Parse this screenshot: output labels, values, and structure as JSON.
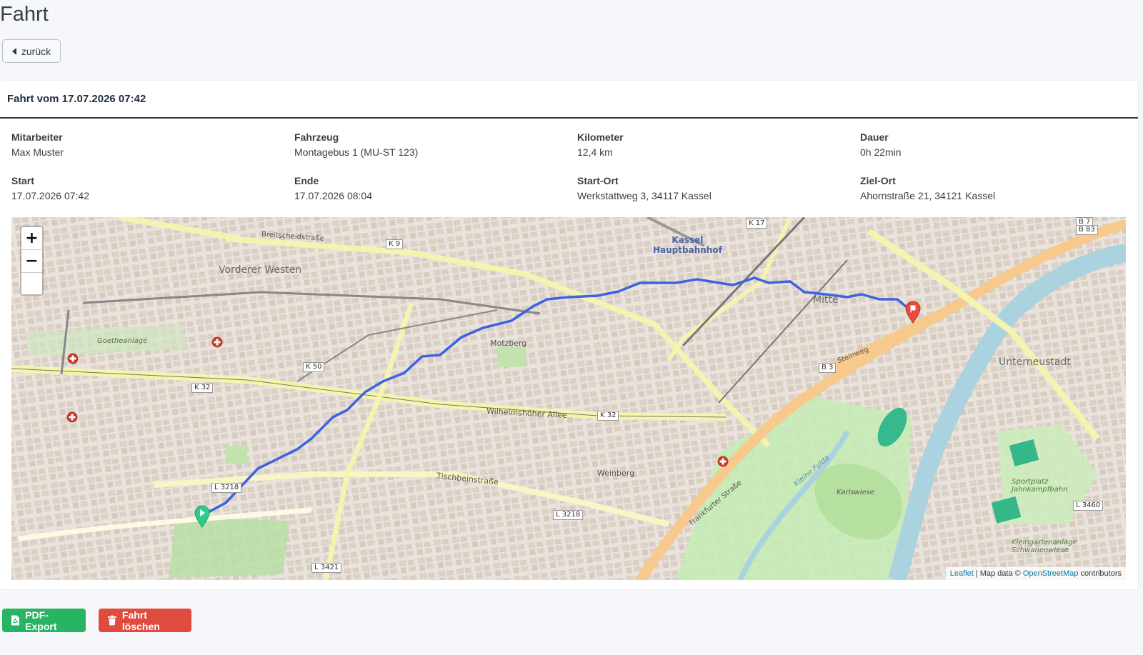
{
  "page": {
    "title": "Fahrt"
  },
  "back_button": {
    "label": "zurück"
  },
  "card": {
    "title": "Fahrt vom 17.07.2026 07:42"
  },
  "details": [
    {
      "label": "Mitarbeiter",
      "value": "Max Muster"
    },
    {
      "label": "Fahrzeug",
      "value": "Montagebus 1 (MU-ST 123)"
    },
    {
      "label": "Kilometer",
      "value": "12,4 km"
    },
    {
      "label": "Dauer",
      "value": "0h 22min"
    },
    {
      "label": "Start",
      "value": "17.07.2026 07:42"
    },
    {
      "label": "Ende",
      "value": "17.07.2026 08:04"
    },
    {
      "label": "Start-Ort",
      "value": "Werkstattweg 3, 34117 Kassel"
    },
    {
      "label": "Ziel-Ort",
      "value": "Ahornstraße 21, 34121 Kassel"
    }
  ],
  "map": {
    "zoom_in": "+",
    "zoom_out": "−",
    "attribution": {
      "leaflet": "Leaflet",
      "sep": " | Map data © ",
      "osm": "OpenStreetMap",
      "suffix": " contributors"
    },
    "labels": {
      "vorderer_westen": "Vorderer Westen",
      "kassel_hbf_1": "Kassel",
      "kassel_hbf_2": "Hauptbahnhof",
      "mitte": "Mitte",
      "unterneustadt": "Unterneustadt",
      "motzberg": "Motzberg",
      "weinberg": "Weinberg",
      "karlswiese": "Karlswiese",
      "breitscheid": "Breitscheidstraße",
      "wilhelmshoeher": "Wilhelmshöher Allee",
      "tischbein": "Tischbeinstraße",
      "goetheanlage": "Goetheanlage",
      "steinweg": "Steinweg",
      "frankfurter": "Frankfurter Straße",
      "kleine_fulda": "Kleine Fulda",
      "sportplatz_1": "Sportplatz",
      "sportplatz_2": "Jahnkampfbahn",
      "kleingarten_1": "Kleingartenanlage",
      "kleingarten_2": "Schwanenwiese"
    },
    "road_badges": {
      "k9": "K 9",
      "k17": "K 17",
      "k50": "K 50",
      "k32a": "K 32",
      "k32b": "K 32",
      "l3218a": "L 3218",
      "l3218b": "L 3218",
      "l3421": "L 3421",
      "b3": "B 3",
      "l3460": "L 3460",
      "b7": "B 7",
      "b83": "B 83"
    }
  },
  "actions": {
    "pdf_export": "PDF-Export",
    "delete": "Fahrt löschen"
  },
  "colors": {
    "route": "#3d63e0",
    "start_marker": "#2ecc8a",
    "end_marker": "#e74c3c",
    "green_button": "#28b463",
    "red_button": "#e04b3f"
  }
}
